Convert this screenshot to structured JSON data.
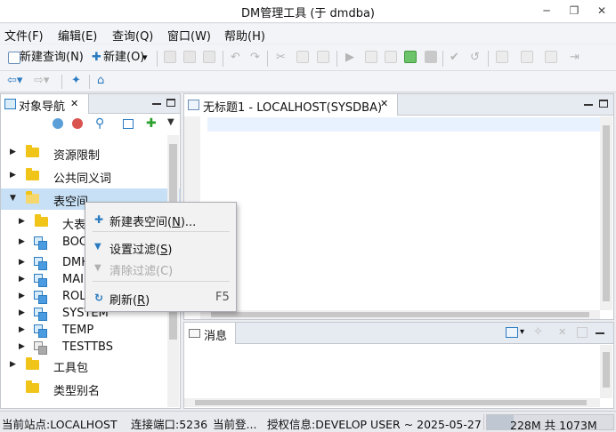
{
  "window": {
    "title": "DM管理工具 (于 dmdba)",
    "minimize": "─",
    "restore": "❐",
    "close": "✕"
  },
  "menubar": [
    {
      "label": "文件(F)"
    },
    {
      "label": "编辑(E)"
    },
    {
      "label": "查询(Q)"
    },
    {
      "label": "窗口(W)"
    },
    {
      "label": "帮助(H)"
    }
  ],
  "toolbar": {
    "new_query": "新建查询(N)",
    "new": "新建(O)",
    "dropdown": "▾"
  },
  "navigator": {
    "title": "对象导航",
    "close": "✕",
    "tree": [
      {
        "label": "资源限制",
        "expander": "▶",
        "icon": "folder-icon"
      },
      {
        "label": "公共同义词",
        "expander": "▶",
        "icon": "folder-icon"
      },
      {
        "label": "表空间",
        "expander": "▼",
        "icon": "folder-open-icon"
      },
      {
        "label": "大表",
        "expander": "▶",
        "icon": "folder-icon"
      },
      {
        "label": "BOC",
        "expander": "▶",
        "icon": "tablespace-icon"
      },
      {
        "label": "DMH",
        "expander": "▶",
        "icon": "tablespace-icon"
      },
      {
        "label": "MAIN",
        "expander": "▶",
        "icon": "tablespace-icon"
      },
      {
        "label": "ROL",
        "expander": "▶",
        "icon": "tablespace-icon"
      },
      {
        "label": "SYSTEM",
        "expander": "▶",
        "icon": "tablespace-icon"
      },
      {
        "label": "TEMP",
        "expander": "▶",
        "icon": "tablespace-icon"
      },
      {
        "label": "TESTTBS",
        "expander": "▶",
        "icon": "tablespace-grey-icon"
      },
      {
        "label": "工具包",
        "expander": "▶",
        "icon": "folder-icon"
      },
      {
        "label": "类型别名",
        "expander": "",
        "icon": "folder-icon"
      }
    ]
  },
  "editor": {
    "tab_title": "无标题1 - LOCALHOST(SYSDBA)",
    "close": "✕"
  },
  "messages": {
    "tab_title": "消息"
  },
  "context_menu": {
    "items": [
      {
        "label": "新建表空间(",
        "key": "N",
        "suffix": ")...",
        "icon": "✚",
        "shortcut": "",
        "enabled": true
      },
      {
        "label": "设置过滤(",
        "key": "S",
        "suffix": ")",
        "icon": "▼",
        "shortcut": "",
        "enabled": true
      },
      {
        "label": "清除过滤(C)",
        "key": "",
        "suffix": "",
        "icon": "▼",
        "shortcut": "",
        "enabled": false
      },
      {
        "label": "刷新(",
        "key": "R",
        "suffix": ")",
        "icon": "↻",
        "shortcut": "F5",
        "enabled": true
      }
    ]
  },
  "status": {
    "site": "当前站点:LOCALHOST",
    "port": "连接端口:5236",
    "login": "当前登...",
    "license": "授权信息:DEVELOP USER ~ 2025-05-27",
    "memory": "228M 共 1073M"
  },
  "colors": {
    "selection": "#c7e0f5",
    "accent": "#2a7bc0",
    "folder": "#f0c419"
  }
}
